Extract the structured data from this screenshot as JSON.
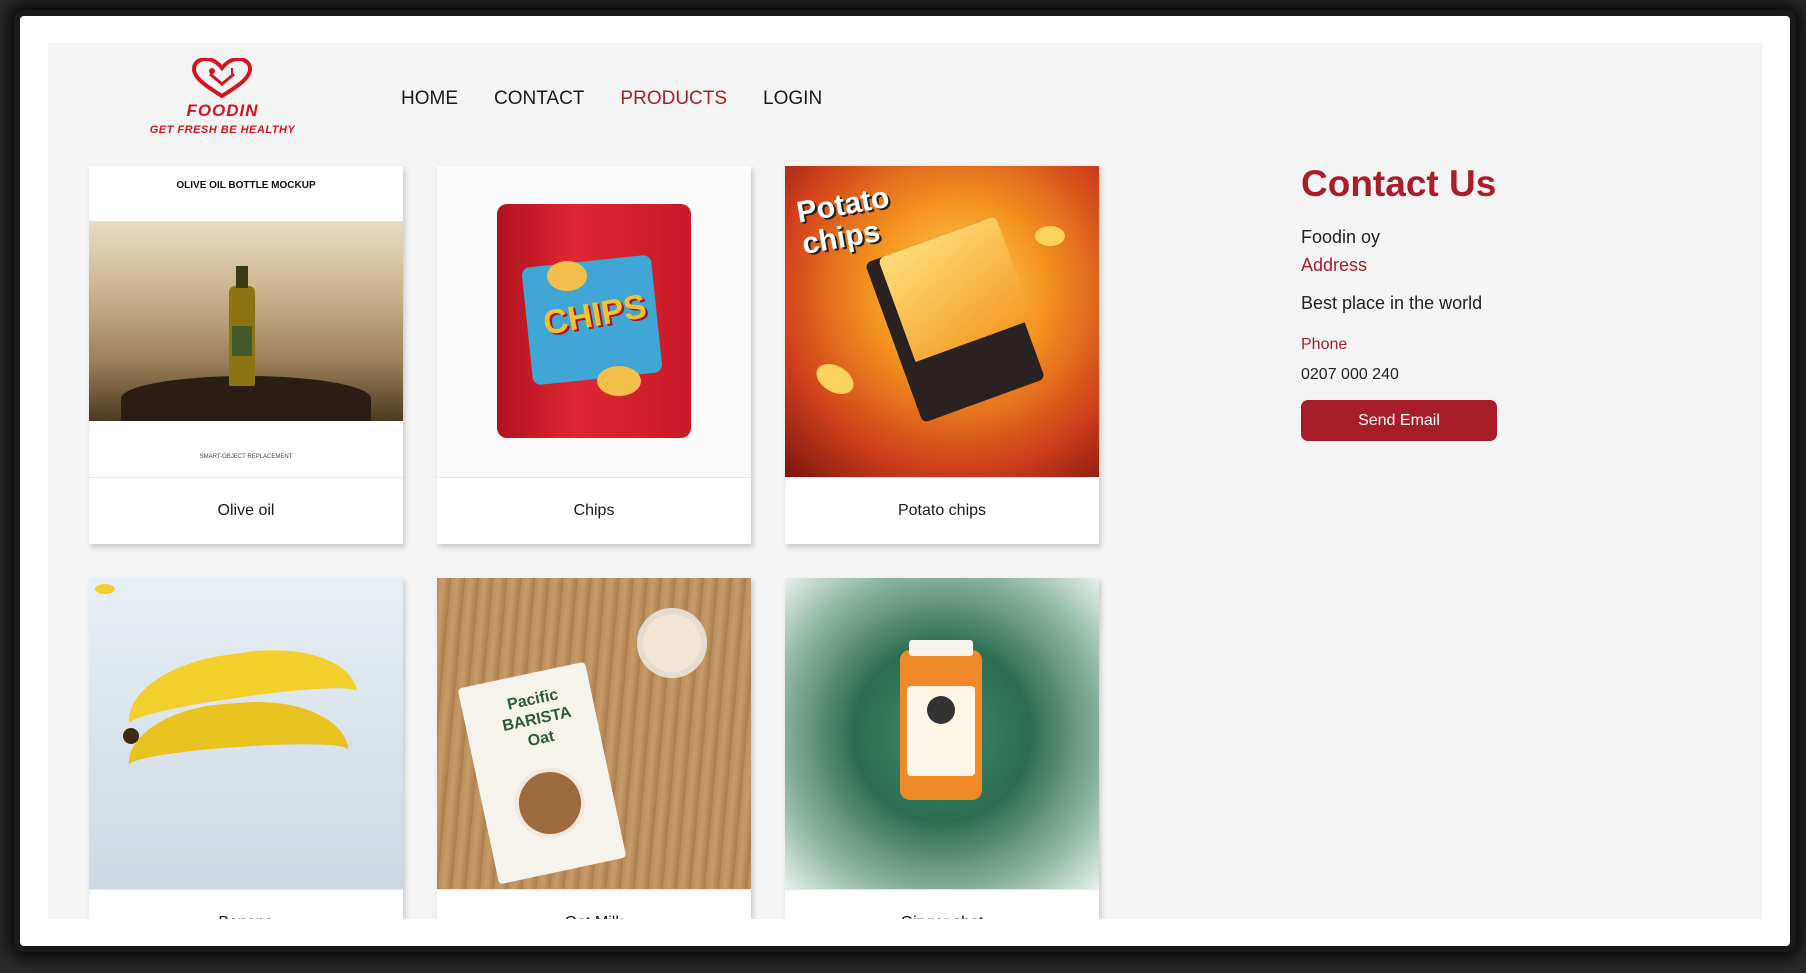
{
  "brand": {
    "name": "FOODIN",
    "tagline": "GET FRESH BE HEALTHY",
    "logo_icon": "heart-fork-spoon-icon",
    "color": "#d3151d"
  },
  "nav": {
    "items": [
      {
        "label": "HOME",
        "active": false
      },
      {
        "label": "CONTACT",
        "active": false
      },
      {
        "label": "PRODUCTS",
        "active": true
      },
      {
        "label": "LOGIN",
        "active": false
      }
    ]
  },
  "products": [
    {
      "label": "Olive oil",
      "image": "olive-oil-bottle-image",
      "image_title": "OLIVE OIL BOTTLE MOCKUP",
      "image_caption": "SMART-OBJECT REPLACEMENT"
    },
    {
      "label": "Chips",
      "image": "chips-bag-image",
      "image_text": "CHIPS"
    },
    {
      "label": "Potato chips",
      "image": "potato-chips-ad-image",
      "image_text": "Potato chips"
    },
    {
      "label": "Banana",
      "image": "banana-image"
    },
    {
      "label": "Oat Milk",
      "image": "oat-milk-carton-image",
      "image_text": "Pacific BARISTA Oat"
    },
    {
      "label": "Ginger shot",
      "image": "juice-bottle-image"
    }
  ],
  "contact": {
    "title": "Contact Us",
    "company": "Foodin oy",
    "address_label": "Address",
    "address": "Best place in the world",
    "phone_label": "Phone",
    "phone": "0207 000 240",
    "button_label": "Send Email"
  },
  "colors": {
    "accent": "#a71d2a",
    "page_bg": "#f4f4f4"
  }
}
